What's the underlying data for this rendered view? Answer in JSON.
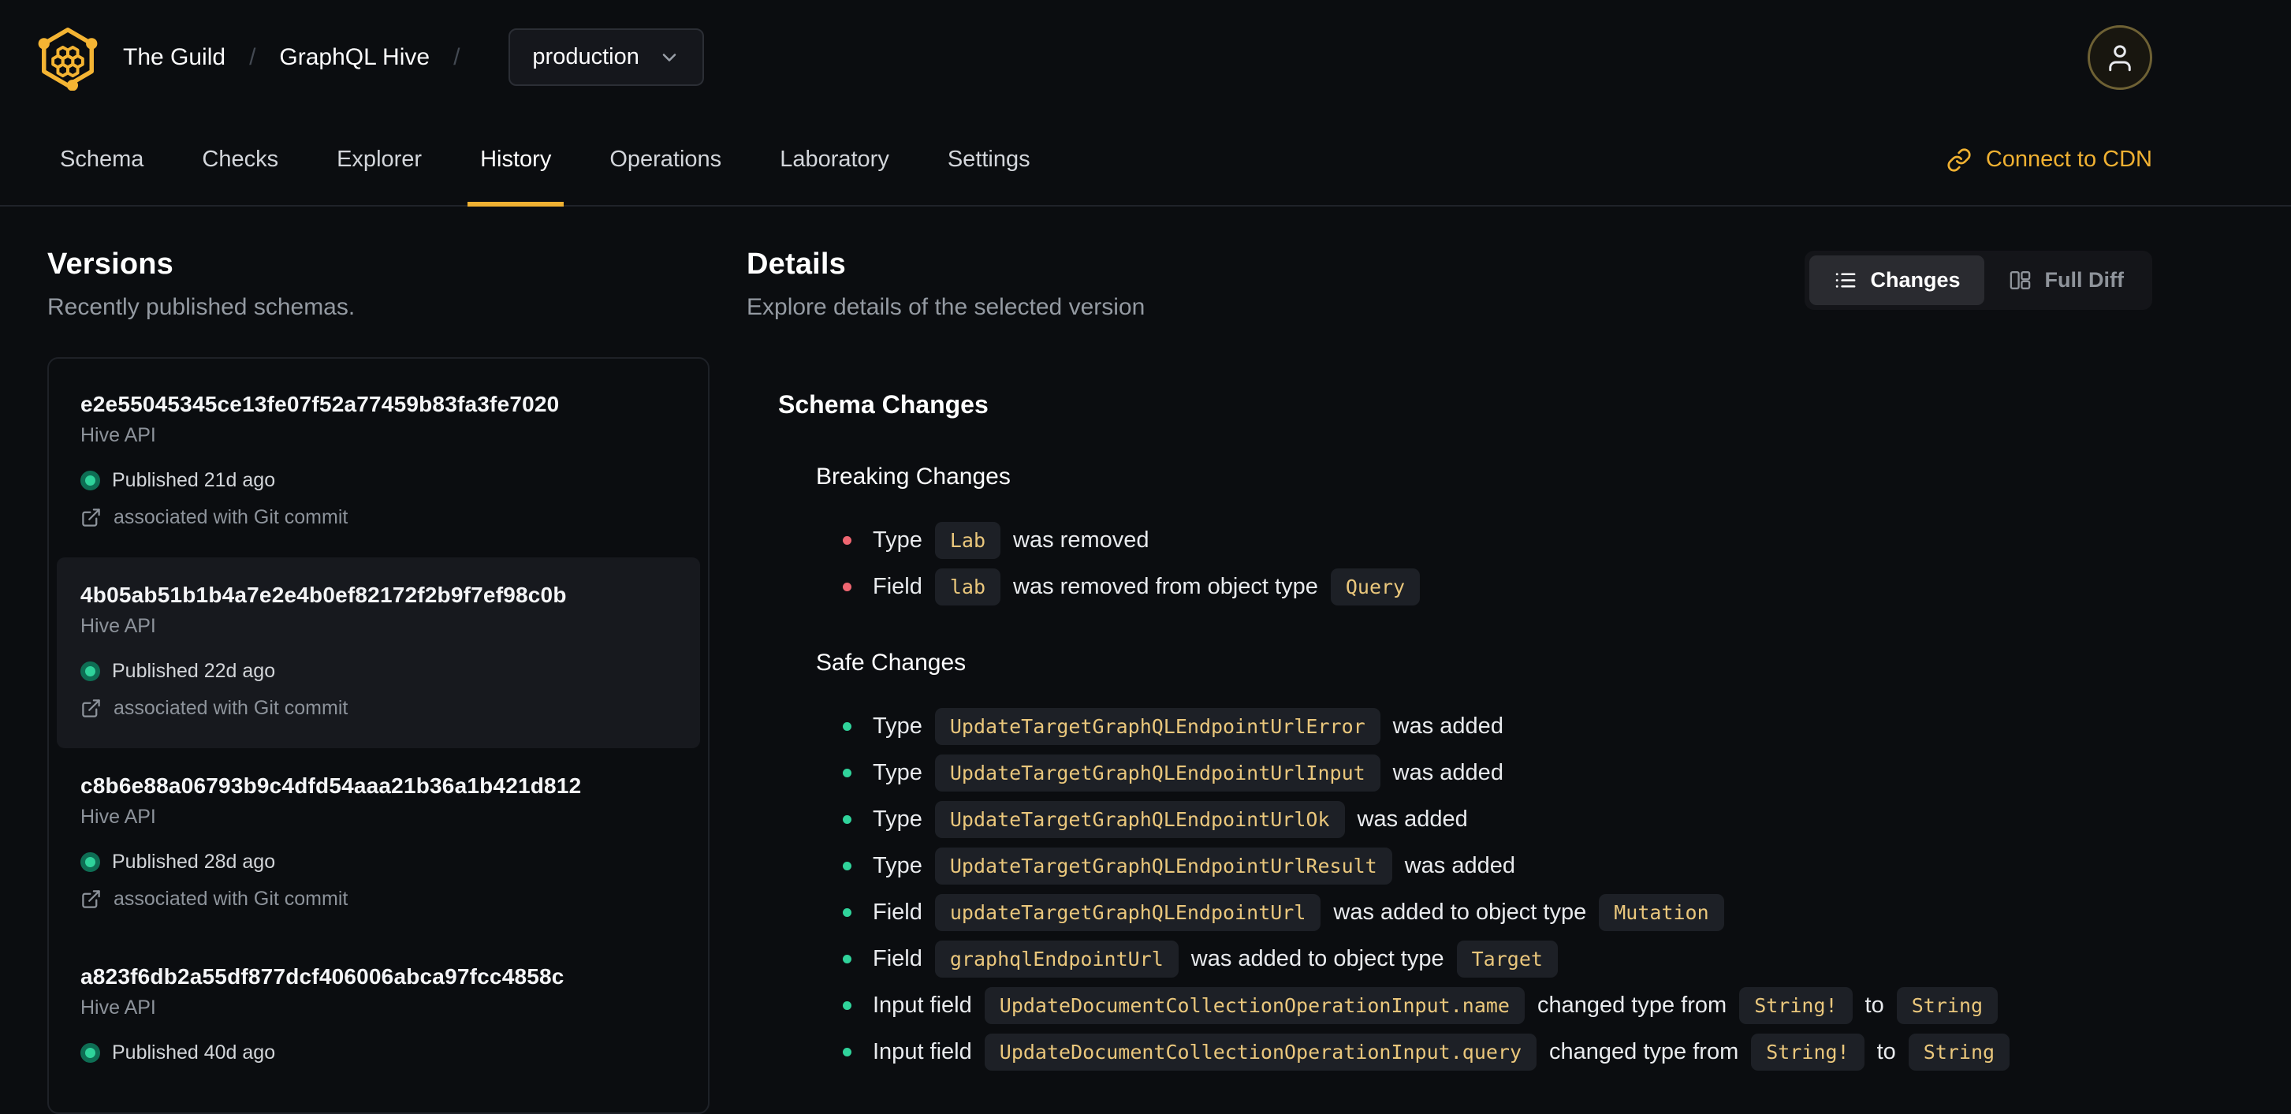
{
  "header": {
    "logo_icon": "hive-logo",
    "org": "The Guild",
    "project": "GraphQL Hive",
    "breadcrumb_separator": "/",
    "target_selector": {
      "value": "production",
      "chevron_icon": "chevron-down-icon"
    },
    "avatar_icon": "user-icon"
  },
  "nav": {
    "tabs": [
      "Schema",
      "Checks",
      "Explorer",
      "History",
      "Operations",
      "Laboratory",
      "Settings"
    ],
    "active_tab": "History",
    "cdn_link": {
      "label": "Connect to CDN",
      "icon": "link-icon"
    }
  },
  "versions_panel": {
    "title": "Versions",
    "subtitle": "Recently published schemas.",
    "items": [
      {
        "hash": "e2e55045345ce13fe07f52a77459b83fa3fe7020",
        "service": "Hive API",
        "published": "Published 21d ago",
        "git_link": "associated with Git commit",
        "selected": false
      },
      {
        "hash": "4b05ab51b1b4a7e2e4b0ef82172f2b9f7ef98c0b",
        "service": "Hive API",
        "published": "Published 22d ago",
        "git_link": "associated with Git commit",
        "selected": true
      },
      {
        "hash": "c8b6e88a06793b9c4dfd54aaa21b36a1b421d812",
        "service": "Hive API",
        "published": "Published 28d ago",
        "git_link": "associated with Git commit",
        "selected": false
      },
      {
        "hash": "a823f6db2a55df877dcf406006abca97fcc4858c",
        "service": "Hive API",
        "published": "Published 40d ago",
        "selected": false
      }
    ]
  },
  "details_panel": {
    "title": "Details",
    "subtitle": "Explore details of the selected version",
    "view_toggle": [
      {
        "label": "Changes",
        "icon": "list-icon",
        "active": true
      },
      {
        "label": "Full Diff",
        "icon": "columns-icon",
        "active": false
      }
    ],
    "schema_changes": {
      "title": "Schema Changes",
      "groups": [
        {
          "title": "Breaking Changes",
          "severity": "breaking",
          "bullet_color": "#ef6671",
          "items": [
            [
              {
                "text": "Type"
              },
              {
                "code": "Lab"
              },
              {
                "text": "was removed"
              }
            ],
            [
              {
                "text": "Field"
              },
              {
                "code": "lab"
              },
              {
                "text": "was removed from object type"
              },
              {
                "code": "Query"
              }
            ]
          ]
        },
        {
          "title": "Safe Changes",
          "severity": "safe",
          "bullet_color": "#30d39b",
          "items": [
            [
              {
                "text": "Type"
              },
              {
                "code": "UpdateTargetGraphQLEndpointUrlError"
              },
              {
                "text": "was added"
              }
            ],
            [
              {
                "text": "Type"
              },
              {
                "code": "UpdateTargetGraphQLEndpointUrlInput"
              },
              {
                "text": "was added"
              }
            ],
            [
              {
                "text": "Type"
              },
              {
                "code": "UpdateTargetGraphQLEndpointUrlOk"
              },
              {
                "text": "was added"
              }
            ],
            [
              {
                "text": "Type"
              },
              {
                "code": "UpdateTargetGraphQLEndpointUrlResult"
              },
              {
                "text": "was added"
              }
            ],
            [
              {
                "text": "Field"
              },
              {
                "code": "updateTargetGraphQLEndpointUrl"
              },
              {
                "text": "was added to object type"
              },
              {
                "code": "Mutation"
              }
            ],
            [
              {
                "text": "Field"
              },
              {
                "code": "graphqlEndpointUrl"
              },
              {
                "text": "was added to object type"
              },
              {
                "code": "Target"
              }
            ],
            [
              {
                "text": "Input field"
              },
              {
                "code": "UpdateDocumentCollectionOperationInput.name"
              },
              {
                "text": "changed type from"
              },
              {
                "code": "String!"
              },
              {
                "text": "to"
              },
              {
                "code": "String"
              }
            ],
            [
              {
                "text": "Input field"
              },
              {
                "code": "UpdateDocumentCollectionOperationInput.query"
              },
              {
                "text": "changed type from"
              },
              {
                "code": "String!"
              },
              {
                "text": "to"
              },
              {
                "code": "String"
              }
            ]
          ]
        }
      ]
    }
  },
  "colors": {
    "background": "#0b0d10",
    "accent_gold": "#f0b132",
    "breaking_bullet": "#ef6671",
    "safe_bullet": "#30d39b",
    "published_dot": "#2fd39b",
    "code_text": "#eac77c"
  }
}
